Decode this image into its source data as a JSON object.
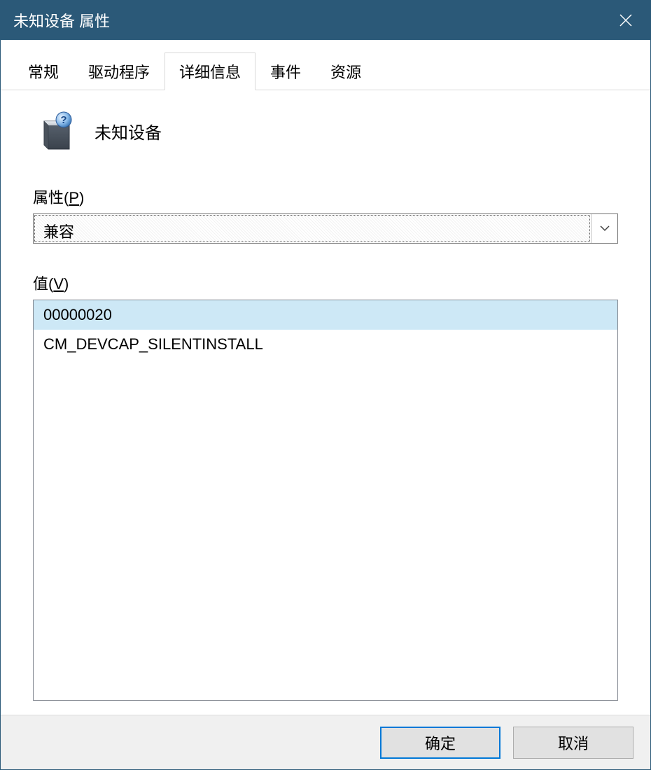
{
  "window": {
    "title": "未知设备 属性"
  },
  "tabs": {
    "items": [
      {
        "label": "常规"
      },
      {
        "label": "驱动程序"
      },
      {
        "label": "详细信息"
      },
      {
        "label": "事件"
      },
      {
        "label": "资源"
      }
    ],
    "activeIndex": 2
  },
  "device": {
    "name": "未知设备"
  },
  "property": {
    "label_prefix": "属性(",
    "hotkey": "P",
    "label_suffix": ")",
    "selected": "兼容"
  },
  "values": {
    "label_prefix": "值(",
    "hotkey": "V",
    "label_suffix": ")",
    "items": [
      "00000020",
      "CM_DEVCAP_SILENTINSTALL"
    ],
    "selectedIndex": 0
  },
  "buttons": {
    "ok": "确定",
    "cancel": "取消"
  }
}
